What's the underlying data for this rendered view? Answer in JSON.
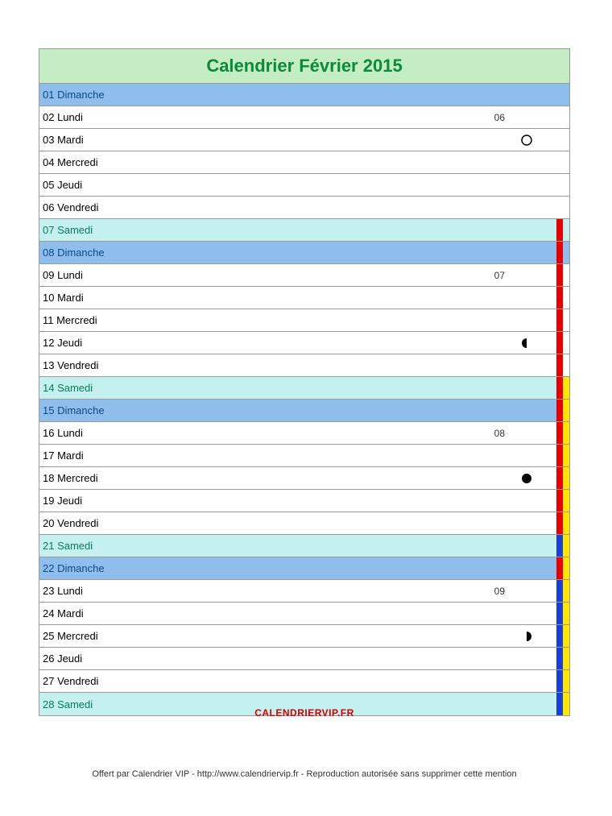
{
  "title": "Calendrier Février 2015",
  "site_label": "CALENDRIERVIP.FR",
  "footer": "Offert par Calendrier VIP - http://www.calendriervip.fr - Reproduction autorisée sans supprimer cette mention",
  "colors": {
    "red": "#e60000",
    "blue": "#1a3fd6",
    "yellow": "#ffe600"
  },
  "days": [
    {
      "num": "01",
      "name": "Dimanche",
      "type": "sunday",
      "week": "",
      "moon": "",
      "bars": [
        "",
        ""
      ]
    },
    {
      "num": "02",
      "name": "Lundi",
      "type": "weekday",
      "week": "06",
      "moon": "",
      "bars": [
        "",
        ""
      ]
    },
    {
      "num": "03",
      "name": "Mardi",
      "type": "weekday",
      "week": "",
      "moon": "full",
      "bars": [
        "",
        ""
      ]
    },
    {
      "num": "04",
      "name": "Mercredi",
      "type": "weekday",
      "week": "",
      "moon": "",
      "bars": [
        "",
        ""
      ]
    },
    {
      "num": "05",
      "name": "Jeudi",
      "type": "weekday",
      "week": "",
      "moon": "",
      "bars": [
        "",
        ""
      ]
    },
    {
      "num": "06",
      "name": "Vendredi",
      "type": "weekday",
      "week": "",
      "moon": "",
      "bars": [
        "",
        ""
      ]
    },
    {
      "num": "07",
      "name": "Samedi",
      "type": "saturday",
      "week": "",
      "moon": "",
      "bars": [
        "red",
        ""
      ]
    },
    {
      "num": "08",
      "name": "Dimanche",
      "type": "sunday",
      "week": "",
      "moon": "",
      "bars": [
        "red",
        ""
      ]
    },
    {
      "num": "09",
      "name": "Lundi",
      "type": "weekday",
      "week": "07",
      "moon": "",
      "bars": [
        "red",
        ""
      ]
    },
    {
      "num": "10",
      "name": "Mardi",
      "type": "weekday",
      "week": "",
      "moon": "",
      "bars": [
        "red",
        ""
      ]
    },
    {
      "num": "11",
      "name": "Mercredi",
      "type": "weekday",
      "week": "",
      "moon": "",
      "bars": [
        "red",
        ""
      ]
    },
    {
      "num": "12",
      "name": "Jeudi",
      "type": "weekday",
      "week": "",
      "moon": "lastq",
      "bars": [
        "red",
        ""
      ]
    },
    {
      "num": "13",
      "name": "Vendredi",
      "type": "weekday",
      "week": "",
      "moon": "",
      "bars": [
        "red",
        ""
      ]
    },
    {
      "num": "14",
      "name": "Samedi",
      "type": "saturday",
      "week": "",
      "moon": "",
      "bars": [
        "red",
        "yellow"
      ]
    },
    {
      "num": "15",
      "name": "Dimanche",
      "type": "sunday",
      "week": "",
      "moon": "",
      "bars": [
        "red",
        "yellow"
      ]
    },
    {
      "num": "16",
      "name": "Lundi",
      "type": "weekday",
      "week": "08",
      "moon": "",
      "bars": [
        "red",
        "yellow"
      ]
    },
    {
      "num": "17",
      "name": "Mardi",
      "type": "weekday",
      "week": "",
      "moon": "",
      "bars": [
        "red",
        "yellow"
      ]
    },
    {
      "num": "18",
      "name": "Mercredi",
      "type": "weekday",
      "week": "",
      "moon": "new",
      "bars": [
        "red",
        "yellow"
      ]
    },
    {
      "num": "19",
      "name": "Jeudi",
      "type": "weekday",
      "week": "",
      "moon": "",
      "bars": [
        "red",
        "yellow"
      ]
    },
    {
      "num": "20",
      "name": "Vendredi",
      "type": "weekday",
      "week": "",
      "moon": "",
      "bars": [
        "red",
        "yellow"
      ]
    },
    {
      "num": "21",
      "name": "Samedi",
      "type": "saturday",
      "week": "",
      "moon": "",
      "bars": [
        "blue",
        "yellow"
      ]
    },
    {
      "num": "22",
      "name": "Dimanche",
      "type": "sunday",
      "week": "",
      "moon": "",
      "bars": [
        "red",
        "yellow"
      ]
    },
    {
      "num": "23",
      "name": "Lundi",
      "type": "weekday",
      "week": "09",
      "moon": "",
      "bars": [
        "blue",
        "yellow"
      ]
    },
    {
      "num": "24",
      "name": "Mardi",
      "type": "weekday",
      "week": "",
      "moon": "",
      "bars": [
        "blue",
        "yellow"
      ]
    },
    {
      "num": "25",
      "name": "Mercredi",
      "type": "weekday",
      "week": "",
      "moon": "firstq",
      "bars": [
        "blue",
        "yellow"
      ]
    },
    {
      "num": "26",
      "name": "Jeudi",
      "type": "weekday",
      "week": "",
      "moon": "",
      "bars": [
        "blue",
        "yellow"
      ]
    },
    {
      "num": "27",
      "name": "Vendredi",
      "type": "weekday",
      "week": "",
      "moon": "",
      "bars": [
        "blue",
        "yellow"
      ]
    },
    {
      "num": "28",
      "name": "Samedi",
      "type": "saturday",
      "week": "",
      "moon": "",
      "bars": [
        "blue",
        "yellow"
      ]
    }
  ]
}
